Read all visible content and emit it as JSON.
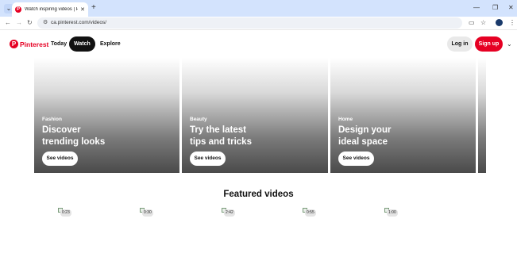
{
  "browser": {
    "tab_title": "Watch inspiring videos | Pinterest",
    "url": "ca.pinterest.com/videos/",
    "icons": [
      "tab-search-icon",
      "new-tab-icon",
      "minimize-icon",
      "maximize-icon",
      "close-icon",
      "back-icon",
      "forward-icon",
      "reload-icon",
      "site-info-icon",
      "cast-icon",
      "bookmark-star-icon",
      "profile-icon",
      "menu-icon"
    ]
  },
  "header": {
    "brand": "Pinterest",
    "nav": [
      {
        "label": "Today"
      },
      {
        "label": "Watch",
        "active": true
      },
      {
        "label": "Explore"
      }
    ],
    "login_label": "Log in",
    "signup_label": "Sign up",
    "brand_color": "#e60023"
  },
  "hero_cards": [
    {
      "category": "Fashion",
      "headline": "Discover trending looks",
      "cta": "See videos"
    },
    {
      "category": "Beauty",
      "headline": "Try the latest tips and tricks",
      "cta": "See videos"
    },
    {
      "category": "Home",
      "headline": "Design your ideal space",
      "cta": "See videos"
    }
  ],
  "featured": {
    "title": "Featured videos",
    "videos": [
      {
        "duration": "0:23"
      },
      {
        "duration": "0:30"
      },
      {
        "duration": "2:42"
      },
      {
        "duration": "0:55"
      },
      {
        "duration": "1:00"
      }
    ]
  }
}
